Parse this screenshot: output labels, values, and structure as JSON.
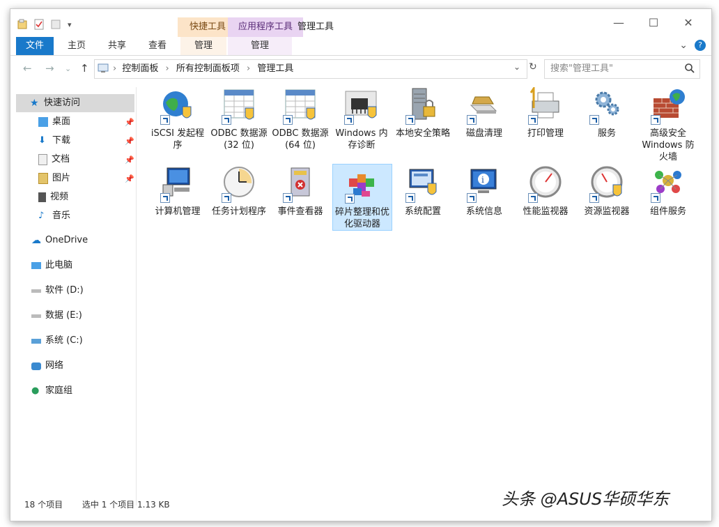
{
  "title": {
    "qat_dropdown": "▾",
    "context_tab_1": "快捷工具",
    "context_tab_2": "应用程序工具",
    "window_title": "管理工具"
  },
  "window_controls": {
    "minimize": "—",
    "maximize": "☐",
    "close": "✕"
  },
  "ribbon": {
    "tabs": [
      "文件",
      "主页",
      "共享",
      "查看",
      "管理",
      "管理"
    ],
    "file_color": "#1979ca",
    "expand": "⌄",
    "help": "?"
  },
  "nav": {
    "back": "←",
    "forward": "→",
    "recent": "⌄",
    "up": "↑",
    "breadcrumb": [
      "控制面板",
      "所有控制面板项",
      "管理工具"
    ],
    "breadcrumb_sep": "›",
    "dropdown": "⌄",
    "refresh": "↻"
  },
  "search": {
    "placeholder": "搜索\"管理工具\""
  },
  "sidebar": {
    "quick_access": "快速访问",
    "pinned": [
      {
        "label": "桌面"
      },
      {
        "label": "下载"
      },
      {
        "label": "文档"
      },
      {
        "label": "图片"
      }
    ],
    "recent": [
      {
        "label": "视频"
      },
      {
        "label": "音乐"
      }
    ],
    "drives": [
      {
        "label": "OneDrive"
      },
      {
        "label": "此电脑"
      },
      {
        "label": "软件 (D:)"
      },
      {
        "label": "数据 (E:)"
      },
      {
        "label": "系统 (C:)"
      },
      {
        "label": "网络"
      },
      {
        "label": "家庭组"
      }
    ]
  },
  "files": [
    {
      "name": "iSCSI 发起程序",
      "icon": "globe-shield-icon"
    },
    {
      "name": "ODBC 数据源(32 位)",
      "icon": "database-table-icon"
    },
    {
      "name": "ODBC 数据源(64 位)",
      "icon": "database-table-icon"
    },
    {
      "name": "Windows 内存诊断",
      "icon": "memory-chip-icon"
    },
    {
      "name": "本地安全策略",
      "icon": "server-lock-icon"
    },
    {
      "name": "磁盘清理",
      "icon": "disk-cleanup-icon"
    },
    {
      "name": "打印管理",
      "icon": "printer-icon"
    },
    {
      "name": "服务",
      "icon": "gears-icon"
    },
    {
      "name": "高级安全 Windows 防火墙",
      "icon": "firewall-icon"
    },
    {
      "name": "计算机管理",
      "icon": "computer-management-icon"
    },
    {
      "name": "任务计划程序",
      "icon": "clock-icon"
    },
    {
      "name": "事件查看器",
      "icon": "event-viewer-icon"
    },
    {
      "name": "碎片整理和优化驱动器",
      "icon": "defrag-icon",
      "selected": true
    },
    {
      "name": "系统配置",
      "icon": "system-config-icon"
    },
    {
      "name": "系统信息",
      "icon": "system-info-icon"
    },
    {
      "name": "性能监视器",
      "icon": "gauge-icon"
    },
    {
      "name": "资源监视器",
      "icon": "resource-gauge-icon"
    },
    {
      "name": "组件服务",
      "icon": "component-services-icon"
    }
  ],
  "status": {
    "item_count": "18 个项目",
    "selected": "选中 1 个项目 1.13 KB"
  },
  "watermark": "头条 @ASUS华硕华东"
}
